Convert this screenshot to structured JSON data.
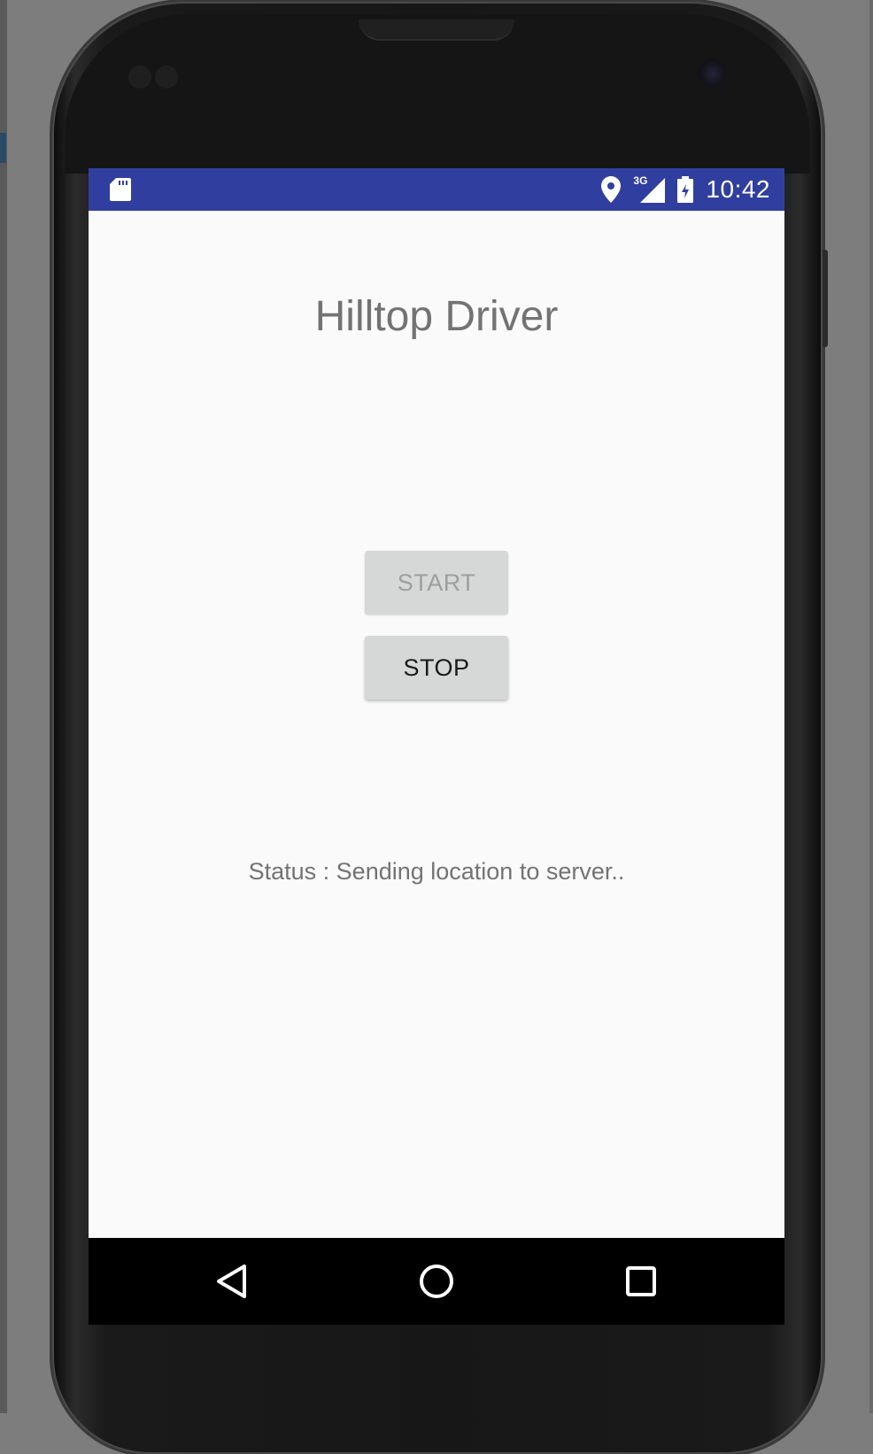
{
  "statusbar": {
    "clock": "10:42",
    "network_label": "3G",
    "icons": [
      "sd-card-icon",
      "location-icon",
      "signal-icon",
      "battery-icon"
    ],
    "background_color": "#303f9f"
  },
  "app": {
    "title": "Hilltop Driver",
    "start_label": "START",
    "stop_label": "STOP",
    "start_enabled": false,
    "stop_enabled": true,
    "status_text": "Status : Sending location to server.."
  },
  "navbar": {
    "icons": [
      "back-icon",
      "home-icon",
      "recents-icon"
    ]
  }
}
